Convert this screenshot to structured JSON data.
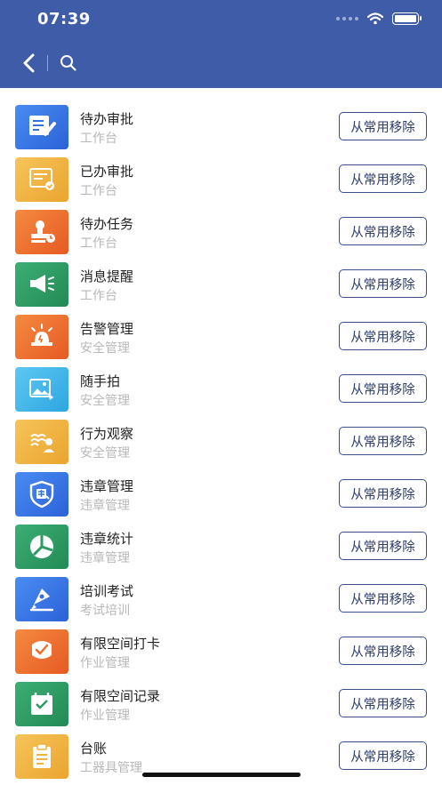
{
  "status_bar": {
    "time": "07:39"
  },
  "colors": {
    "header": "#3f5ca8",
    "blue": "#3370e0",
    "yellow": "#f0b43c",
    "orange": "#ec6a2a",
    "green": "#2c9a62",
    "cyan": "#3bb7ea",
    "button_border": "#3a5089"
  },
  "items": [
    {
      "title": "待办审批",
      "subtitle": "工作台",
      "icon": "document-edit-icon",
      "color": "blue",
      "button": "从常用移除"
    },
    {
      "title": "已办审批",
      "subtitle": "工作台",
      "icon": "document-check-icon",
      "color": "yellow",
      "button": "从常用移除"
    },
    {
      "title": "待办任务",
      "subtitle": "工作台",
      "icon": "stamp-clock-icon",
      "color": "orange",
      "button": "从常用移除"
    },
    {
      "title": "消息提醒",
      "subtitle": "工作台",
      "icon": "megaphone-icon",
      "color": "green",
      "button": "从常用移除"
    },
    {
      "title": "告警管理",
      "subtitle": "安全管理",
      "icon": "alarm-light-icon",
      "color": "orange",
      "button": "从常用移除"
    },
    {
      "title": "随手拍",
      "subtitle": "安全管理",
      "icon": "photo-icon",
      "color": "cyan",
      "button": "从常用移除"
    },
    {
      "title": "行为观察",
      "subtitle": "安全管理",
      "icon": "observe-person-icon",
      "color": "yellow",
      "button": "从常用移除"
    },
    {
      "title": "违章管理",
      "subtitle": "违章管理",
      "icon": "violation-shield-icon",
      "color": "blue",
      "button": "从常用移除"
    },
    {
      "title": "违章统计",
      "subtitle": "违章管理",
      "icon": "pie-chart-icon",
      "color": "green",
      "button": "从常用移除"
    },
    {
      "title": "培训考试",
      "subtitle": "考试培训",
      "icon": "pen-nib-icon",
      "color": "blue",
      "button": "从常用移除"
    },
    {
      "title": "有限空间打卡",
      "subtitle": "作业管理",
      "icon": "checkin-icon",
      "color": "orange",
      "button": "从常用移除"
    },
    {
      "title": "有限空间记录",
      "subtitle": "作业管理",
      "icon": "record-calendar-icon",
      "color": "green",
      "button": "从常用移除"
    },
    {
      "title": "台账",
      "subtitle": "工器具管理",
      "icon": "clipboard-icon",
      "color": "yellow",
      "button": "从常用移除"
    }
  ]
}
